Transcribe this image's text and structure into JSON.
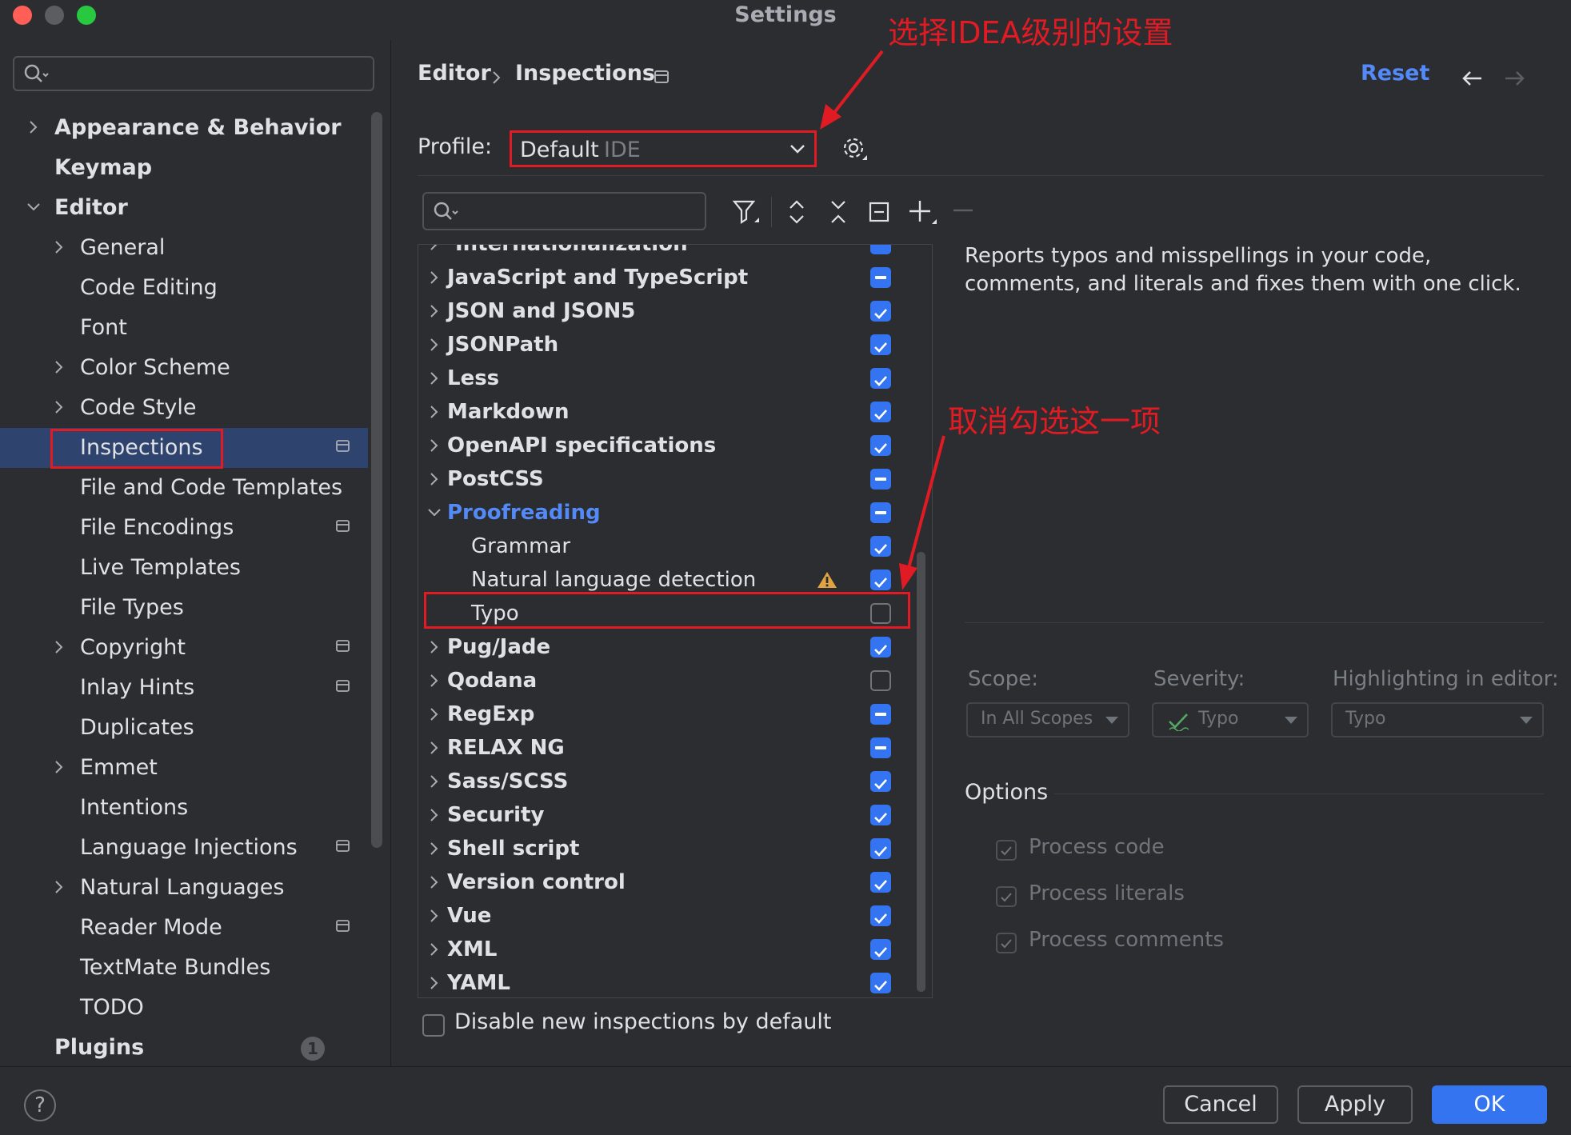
{
  "window": {
    "title": "Settings"
  },
  "colors": {
    "accent": "#3574f0",
    "selection": "#2e436e",
    "annotation": "#e01b24",
    "link": "#548af7"
  },
  "sidebar": {
    "items": [
      {
        "label": "Appearance & Behavior",
        "level": 0,
        "chevron": "right",
        "bold": true
      },
      {
        "label": "Keymap",
        "level": 0,
        "chevron": "none",
        "bold": true
      },
      {
        "label": "Editor",
        "level": 0,
        "chevron": "down",
        "bold": true
      },
      {
        "label": "General",
        "level": 1,
        "chevron": "right"
      },
      {
        "label": "Code Editing",
        "level": 1,
        "chevron": "none"
      },
      {
        "label": "Font",
        "level": 1,
        "chevron": "none"
      },
      {
        "label": "Color Scheme",
        "level": 1,
        "chevron": "right"
      },
      {
        "label": "Code Style",
        "level": 1,
        "chevron": "right"
      },
      {
        "label": "Inspections",
        "level": 1,
        "chevron": "none",
        "selected": true,
        "tag": true
      },
      {
        "label": "File and Code Templates",
        "level": 1,
        "chevron": "none"
      },
      {
        "label": "File Encodings",
        "level": 1,
        "chevron": "none",
        "tag": true
      },
      {
        "label": "Live Templates",
        "level": 1,
        "chevron": "none"
      },
      {
        "label": "File Types",
        "level": 1,
        "chevron": "none"
      },
      {
        "label": "Copyright",
        "level": 1,
        "chevron": "right",
        "tag": true
      },
      {
        "label": "Inlay Hints",
        "level": 1,
        "chevron": "none",
        "tag": true
      },
      {
        "label": "Duplicates",
        "level": 1,
        "chevron": "none"
      },
      {
        "label": "Emmet",
        "level": 1,
        "chevron": "right"
      },
      {
        "label": "Intentions",
        "level": 1,
        "chevron": "none"
      },
      {
        "label": "Language Injections",
        "level": 1,
        "chevron": "none",
        "tag": true
      },
      {
        "label": "Natural Languages",
        "level": 1,
        "chevron": "right"
      },
      {
        "label": "Reader Mode",
        "level": 1,
        "chevron": "none",
        "tag": true
      },
      {
        "label": "TextMate Bundles",
        "level": 1,
        "chevron": "none"
      },
      {
        "label": "TODO",
        "level": 1,
        "chevron": "none"
      },
      {
        "label": "Plugins",
        "level": 0,
        "chevron": "none",
        "bold": true,
        "badge": "1"
      }
    ]
  },
  "breadcrumb": {
    "parent": "Editor",
    "current": "Inspections"
  },
  "header": {
    "reset_label": "Reset"
  },
  "profile": {
    "label": "Profile:",
    "value": "Default",
    "scope": "IDE"
  },
  "inspections": {
    "cut_off_label": "Internationalization",
    "rows": [
      {
        "label": "JavaScript and TypeScript",
        "state": "partial",
        "level": 0
      },
      {
        "label": "JSON and JSON5",
        "state": "checked",
        "level": 0
      },
      {
        "label": "JSONPath",
        "state": "checked",
        "level": 0
      },
      {
        "label": "Less",
        "state": "checked",
        "level": 0
      },
      {
        "label": "Markdown",
        "state": "checked",
        "level": 0
      },
      {
        "label": "OpenAPI specifications",
        "state": "checked",
        "level": 0
      },
      {
        "label": "PostCSS",
        "state": "partial",
        "level": 0
      },
      {
        "label": "Proofreading",
        "state": "partial",
        "level": 0,
        "expanded": true,
        "highlight": true
      },
      {
        "label": "Grammar",
        "state": "checked",
        "level": 1
      },
      {
        "label": "Natural language detection",
        "state": "checked",
        "level": 1,
        "warning": true
      },
      {
        "label": "Typo",
        "state": "empty",
        "level": 1,
        "selected": true
      },
      {
        "label": "Pug/Jade",
        "state": "checked",
        "level": 0
      },
      {
        "label": "Qodana",
        "state": "empty",
        "level": 0
      },
      {
        "label": "RegExp",
        "state": "partial",
        "level": 0
      },
      {
        "label": "RELAX NG",
        "state": "partial",
        "level": 0
      },
      {
        "label": "Sass/SCSS",
        "state": "checked",
        "level": 0
      },
      {
        "label": "Security",
        "state": "checked",
        "level": 0
      },
      {
        "label": "Shell script",
        "state": "checked",
        "level": 0
      },
      {
        "label": "Version control",
        "state": "checked",
        "level": 0
      },
      {
        "label": "Vue",
        "state": "checked",
        "level": 0
      },
      {
        "label": "XML",
        "state": "checked",
        "level": 0
      },
      {
        "label": "YAML",
        "state": "checked",
        "level": 0
      }
    ]
  },
  "description": {
    "text": "Reports typos and misspellings in your code, comments, and literals and fixes them with one click."
  },
  "fields": {
    "scope_label": "Scope:",
    "scope_value": "In All Scopes",
    "severity_label": "Severity:",
    "severity_value": "Typo",
    "highlighting_label": "Highlighting in editor:",
    "highlighting_value": "Typo"
  },
  "options": {
    "title": "Options",
    "items": [
      "Process code",
      "Process literals",
      "Process comments"
    ]
  },
  "disable_new_label": "Disable new inspections by default",
  "footer": {
    "cancel": "Cancel",
    "apply": "Apply",
    "ok": "OK",
    "help": "?"
  },
  "annotations": {
    "profile_note": "选择IDEA级别的设置",
    "typo_note": "取消勾选这一项"
  }
}
